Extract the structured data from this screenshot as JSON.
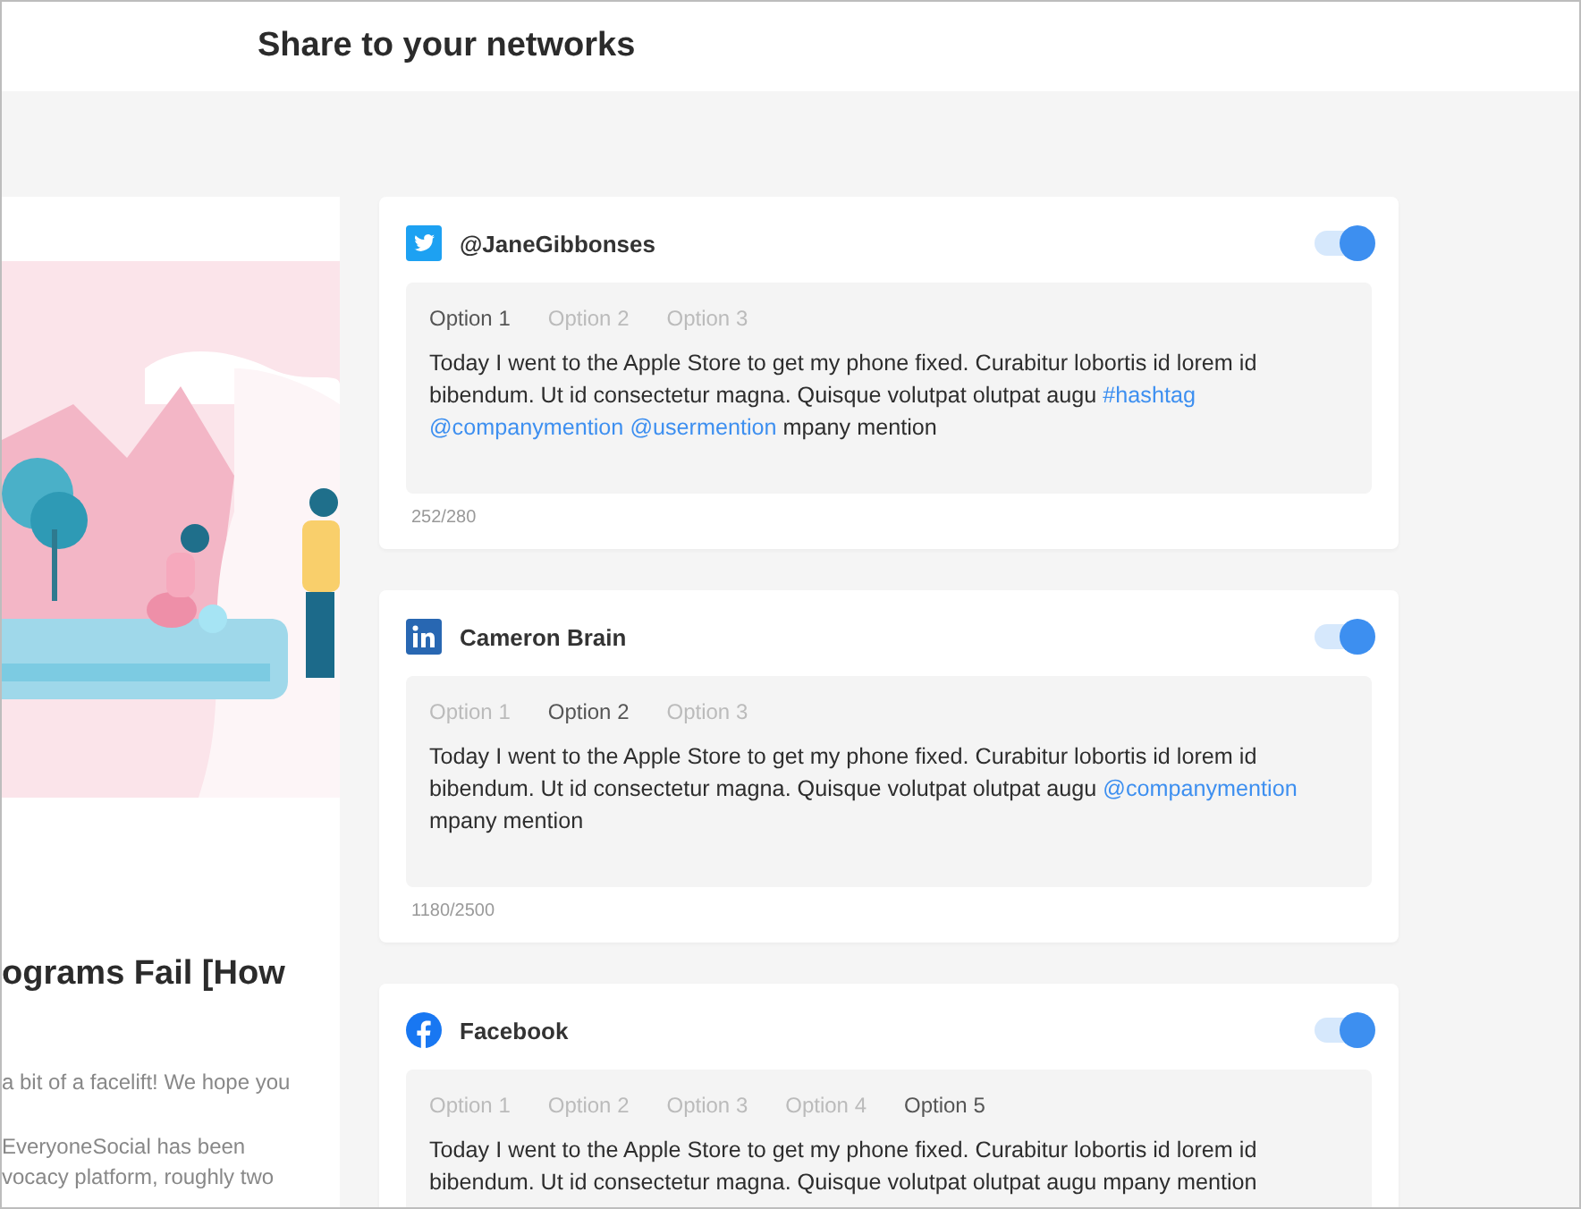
{
  "header": {
    "title": "Share to your networks"
  },
  "article": {
    "title": "ograms Fail [How",
    "excerpt": [
      "a bit of a facelift! We hope you",
      "EveryoneSocial has been",
      "vocacy platform, roughly two"
    ]
  },
  "posts": [
    {
      "kind": "twitter",
      "account": "@JaneGibbonses",
      "on": true,
      "options": [
        {
          "label": "Option 1",
          "selected": true
        },
        {
          "label": "Option 2",
          "selected": false
        },
        {
          "label": "Option 3",
          "selected": false
        }
      ],
      "text": [
        {
          "kind": "plain",
          "text": "Today I went to the Apple Store to get my phone fixed. Curabitur lobortis id lorem id bibendum. Ut id consectetur magna. Quisque volutpat olutpat  augu "
        },
        {
          "kind": "tag",
          "text": "#hashtag"
        },
        {
          "kind": "tag",
          "text": "@companymention"
        },
        {
          "kind": "tag",
          "text": "@usermention"
        },
        {
          "kind": "plain",
          "text": " mpany mention"
        }
      ],
      "count": "252/280"
    },
    {
      "kind": "linkedin",
      "account": "Cameron Brain",
      "on": true,
      "options": [
        {
          "label": "Option 1",
          "selected": false
        },
        {
          "label": "Option 2",
          "selected": true
        },
        {
          "label": "Option 3",
          "selected": false
        }
      ],
      "text": [
        {
          "kind": "plain",
          "text": "Today I went to the Apple Store to get my phone fixed. Curabitur lobortis id lorem id bibendum. Ut id consectetur magna. Quisque volutpat olutpat  augu "
        },
        {
          "kind": "tag",
          "text": "@companymention"
        },
        {
          "kind": "plain",
          "text": " mpany mention"
        }
      ],
      "count": "1180/2500"
    },
    {
      "kind": "facebook",
      "account": "Facebook",
      "on": true,
      "options": [
        {
          "label": "Option 1",
          "selected": false
        },
        {
          "label": "Option 2",
          "selected": false
        },
        {
          "label": "Option 3",
          "selected": false
        },
        {
          "label": "Option 4",
          "selected": false
        },
        {
          "label": "Option 5",
          "selected": true
        }
      ],
      "text": [
        {
          "kind": "plain",
          "text": "Today I went to the Apple Store to get my phone fixed. Curabitur lobortis id lorem id bibendum. Ut id consectetur magna. Quisque volutpat olutpat  augu mpany mention"
        }
      ]
    }
  ]
}
